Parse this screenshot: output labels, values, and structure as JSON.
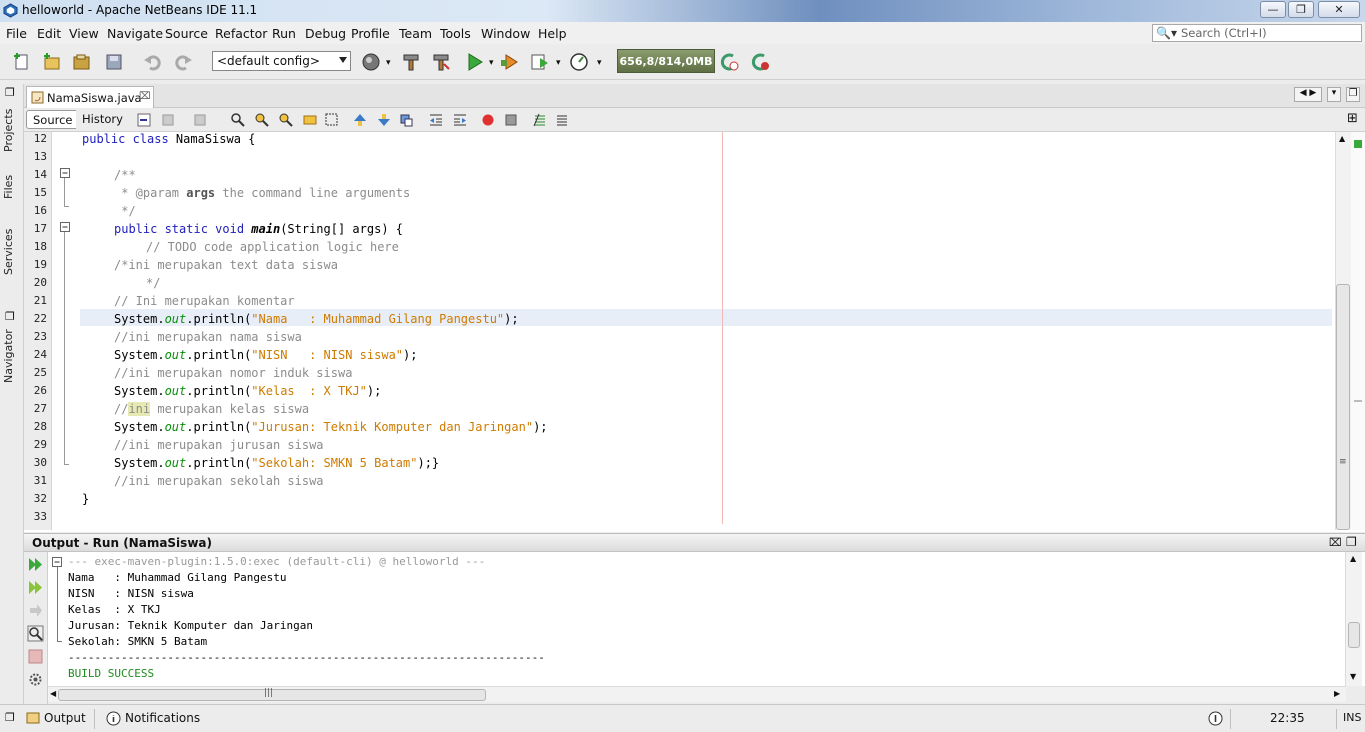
{
  "window": {
    "title": "helloworld - Apache NetBeans IDE 11.1"
  },
  "menu": [
    "File",
    "Edit",
    "View",
    "Navigate",
    "Source",
    "Refactor",
    "Run",
    "Debug",
    "Profile",
    "Team",
    "Tools",
    "Window",
    "Help"
  ],
  "search": {
    "placeholder": "Search (Ctrl+I)"
  },
  "toolbar": {
    "config": "<default config>",
    "memory": "656,8/814,0MB"
  },
  "left_panels": [
    "Projects",
    "Files",
    "Services",
    "Navigator"
  ],
  "editor": {
    "tab": "NamaSiswa.java",
    "source_btn": "Source",
    "history_btn": "History",
    "line_numbers": [
      "12",
      "13",
      "14",
      "15",
      "16",
      "17",
      "18",
      "19",
      "20",
      "21",
      "22",
      "23",
      "24",
      "25",
      "26",
      "27",
      "28",
      "29",
      "30",
      "31",
      "32",
      "33"
    ],
    "code": {
      "l12_kw": "public class ",
      "l12_rest": "NamaSiswa {",
      "l14": "/**",
      "l15_a": " * @param ",
      "l15_b": "args",
      "l15_c": " the command line arguments",
      "l16": " */",
      "l17_kw": "public static void ",
      "l17_m": "main",
      "l17_rest": "(String[] args) {",
      "l18": "// TODO code application logic here",
      "l19": "/*ini merupakan text data siswa",
      "l20": "*/",
      "l21": "// Ini merupakan komentar",
      "sys": "System.",
      "out": "out",
      "println": ".println(",
      "l22_str": "\"Nama   : Muhammad Gilang Pangestu\"",
      "end": ");",
      "l23": "//ini merupakan nama siswa",
      "l24_str": "\"NISN   : NISN siswa\"",
      "l25": "//ini merupakan nomor induk siswa",
      "l26_str": "\"Kelas  : X TKJ\"",
      "l27_a": "//",
      "l27_b": "ini",
      "l27_c": " merupakan kelas siswa",
      "l28_str": "\"Jurusan: Teknik Komputer dan Jaringan\"",
      "l29": "//ini merupakan jurusan siswa",
      "l30_str": "\"Sekolah: SMKN 5 Batam\"",
      "l30_end": ");}",
      "l31": "//ini merupakan sekolah siswa",
      "l32": "}"
    }
  },
  "output": {
    "title": "Output - Run (NamaSiswa)",
    "lines": [
      "--- exec-maven-plugin:1.5.0:exec (default-cli) @ helloworld ---",
      "Nama   : Muhammad Gilang Pangestu",
      "NISN   : NISN siswa",
      "Kelas  : X TKJ",
      "Jurusan: Teknik Komputer dan Jaringan",
      "Sekolah: SMKN 5 Batam",
      "------------------------------------------------------------------------",
      "BUILD SUCCESS"
    ]
  },
  "status": {
    "output_tab": "Output",
    "notifications_tab": "Notifications",
    "position": "22:35",
    "mode": "INS"
  },
  "colors": {
    "keyword": "#1f1fbd",
    "comment": "#8c8c8c",
    "string": "#ce7b00",
    "field": "#0a8f0a",
    "memory_bg": "#6f8055"
  }
}
